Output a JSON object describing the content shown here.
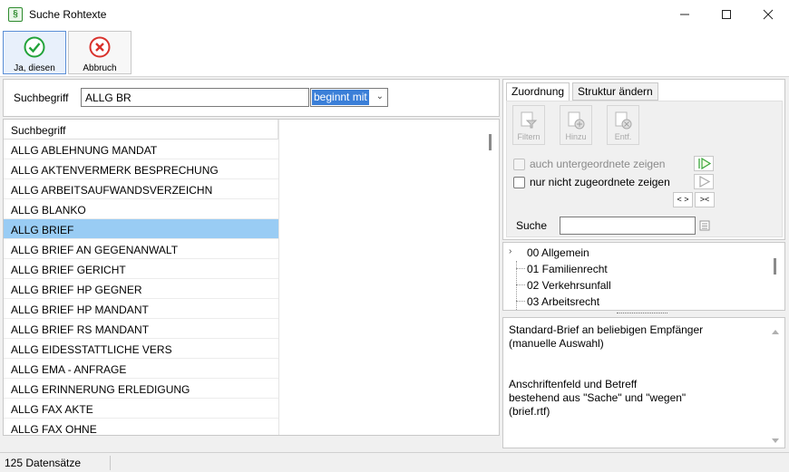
{
  "window": {
    "title": "Suche Rohtexte",
    "app_icon_glyph": "§",
    "min_icon": "minimize-icon",
    "max_icon": "maximize-icon",
    "close_icon": "close-icon"
  },
  "toolbar": {
    "ok_label": "Ja, diesen",
    "cancel_label": "Abbruch",
    "ok_color": "#22a33a",
    "cancel_color": "#d9322c"
  },
  "search": {
    "label": "Suchbegriff",
    "value": "ALLG BR",
    "mode_value": "beginnt mit"
  },
  "grid": {
    "header": "Suchbegriff",
    "rows": [
      "ALLG ABLEHNUNG MANDAT",
      "ALLG AKTENVERMERK BESPRECHUNG",
      "ALLG ARBEITSAUFWANDSVERZEICHN",
      "ALLG BLANKO",
      "ALLG BRIEF",
      "ALLG BRIEF AN GEGENANWALT",
      "ALLG BRIEF GERICHT",
      "ALLG BRIEF HP GEGNER",
      "ALLG BRIEF HP MANDANT",
      "ALLG BRIEF RS MANDANT",
      "ALLG EIDESSTATTLICHE VERS",
      "ALLG EMA - ANFRAGE",
      "ALLG ERINNERUNG ERLEDIGUNG",
      "ALLG FAX AKTE",
      "ALLG FAX OHNE"
    ],
    "selected_index": 4,
    "selection_color": "#99ccf4"
  },
  "right": {
    "tabs": [
      "Zuordnung",
      "Struktur ändern"
    ],
    "buttons": [
      {
        "label": "Filtern",
        "icon": "filter-icon"
      },
      {
        "label": "Hinzu",
        "icon": "add-icon"
      },
      {
        "label": "Entf.",
        "icon": "remove-icon"
      }
    ],
    "check_sub": "auch untergeordnete zeigen",
    "check_unassigned": "nur nicht zugeordnete zeigen",
    "expand_label": "< >",
    "collapse_label": "><",
    "search_label": "Suche",
    "search_value": ""
  },
  "tree": {
    "nodes": [
      "00 Allgemein",
      "01 Familienrecht",
      "02 Verkehrsunfall",
      "03 Arbeitsrecht"
    ]
  },
  "description": {
    "lines": [
      "Standard-Brief an beliebigen Empfänger",
      "(manuelle Auswahl)",
      "",
      "",
      "Anschriftenfeld und Betreff",
      "bestehend aus \"Sache\" und \"wegen\"",
      "(brief.rtf)"
    ]
  },
  "status": {
    "count_text": "125 Datensätze"
  }
}
